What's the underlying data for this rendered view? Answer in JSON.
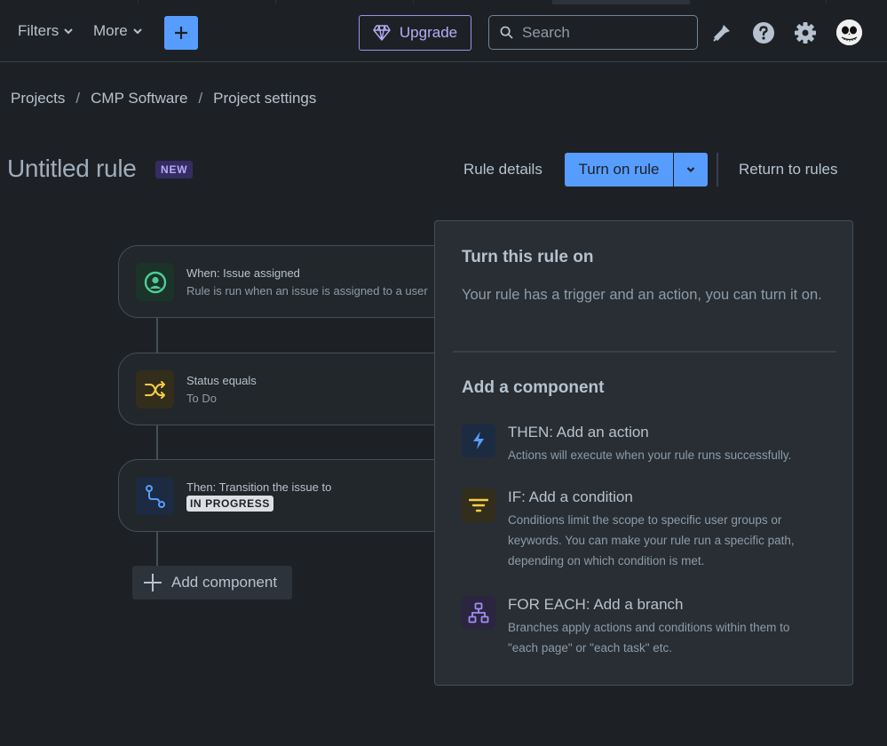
{
  "nav": {
    "filters_label": "Filters",
    "more_label": "More",
    "upgrade_label": "Upgrade",
    "search_placeholder": "Search"
  },
  "breadcrumbs": [
    "Projects",
    "CMP Software",
    "Project settings"
  ],
  "breadcrumb_separator": "/",
  "header": {
    "title": "Untitled rule",
    "badge": "NEW",
    "rule_details_label": "Rule details",
    "turn_on_label": "Turn on rule",
    "return_label": "Return to rules"
  },
  "flow": {
    "trigger": {
      "title": "When: Issue assigned",
      "subtitle": "Rule is run when an issue is assigned to a user"
    },
    "condition": {
      "title": "Status equals",
      "subtitle": "To Do"
    },
    "action": {
      "title": "Then: Transition the issue to",
      "lozenge": "IN PROGRESS"
    },
    "add_component_label": "Add component"
  },
  "popup": {
    "title": "Turn this rule on",
    "description": "Your rule has a trigger and an action, you can turn it on.",
    "section_title": "Add a component",
    "options": [
      {
        "title": "THEN: Add an action",
        "description": "Actions will execute when your rule runs successfully."
      },
      {
        "title": "IF: Add a condition",
        "description": "Conditions limit the scope to specific user groups or keywords. You can make your rule run a specific path, depending on which condition is met."
      },
      {
        "title": "FOR EACH: Add a branch",
        "description": "Branches apply actions and conditions within them to \"each page\" or \"each task\" etc."
      }
    ]
  },
  "colors": {
    "background": "#1d2125",
    "primary": "#579dff",
    "upgrade": "#9f8fef",
    "trigger_icon": "#4bce97",
    "condition_icon": "#f5cd47",
    "action_icon": "#579dff",
    "branch_icon": "#9f8fef"
  },
  "icons": [
    "chevron-down-icon",
    "plus-icon",
    "diamond-icon",
    "search-icon",
    "megaphone-icon",
    "help-icon",
    "gear-icon",
    "avatar",
    "user-circle-icon",
    "shuffle-icon",
    "route-icon",
    "lightning-icon",
    "filter-icon",
    "branch-icon"
  ]
}
